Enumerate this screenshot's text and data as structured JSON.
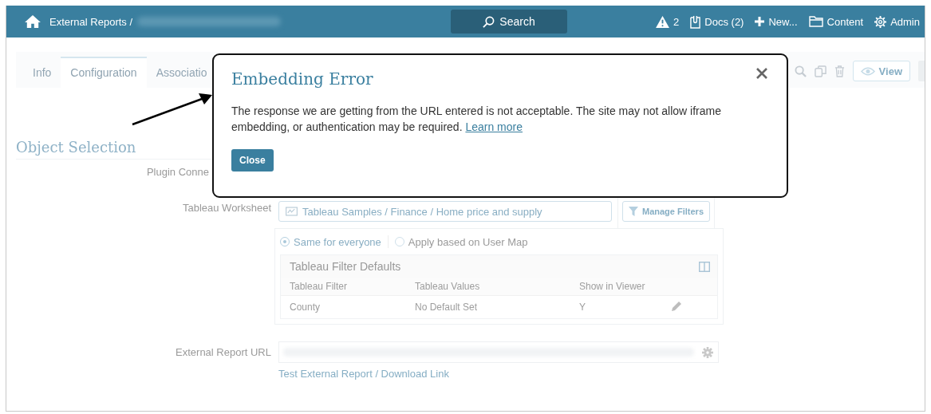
{
  "topbar": {
    "breadcrumb": "External Reports /",
    "search_label": "Search",
    "alerts": "2",
    "docs": "Docs (2)",
    "new_label": "New...",
    "content_label": "Content",
    "admin_label": "Admin"
  },
  "tabs": [
    {
      "label": "Info",
      "selected": false
    },
    {
      "label": "Configuration",
      "selected": true
    },
    {
      "label": "Associatio",
      "selected": false
    }
  ],
  "toolbar": {
    "view_label": "View"
  },
  "section_title": "Object Selection",
  "form": {
    "plugin_label": "Plugin Conne",
    "worksheet_label": "Tableau Worksheet",
    "worksheet_value": "Tableau Samples / Finance / Home price and supply",
    "manage_filters": "Manage Filters",
    "radios": [
      {
        "label": "Same for everyone",
        "selected": true
      },
      {
        "label": "Apply based on User Map",
        "selected": false
      }
    ],
    "filter_table": {
      "title": "Tableau Filter Defaults",
      "columns": [
        "Tableau Filter",
        "Tableau Values",
        "Show in Viewer"
      ],
      "rows": [
        [
          "County",
          "No Default Set",
          "Y"
        ]
      ]
    },
    "url_label": "External Report URL",
    "test_link": "Test External Report / Download Link"
  },
  "modal": {
    "title": "Embedding Error",
    "message": "The response we are getting from the URL entered is not acceptable. The site may not allow iframe embedding, or authentication may be required.",
    "link": "Learn more",
    "close_button": "Close"
  }
}
